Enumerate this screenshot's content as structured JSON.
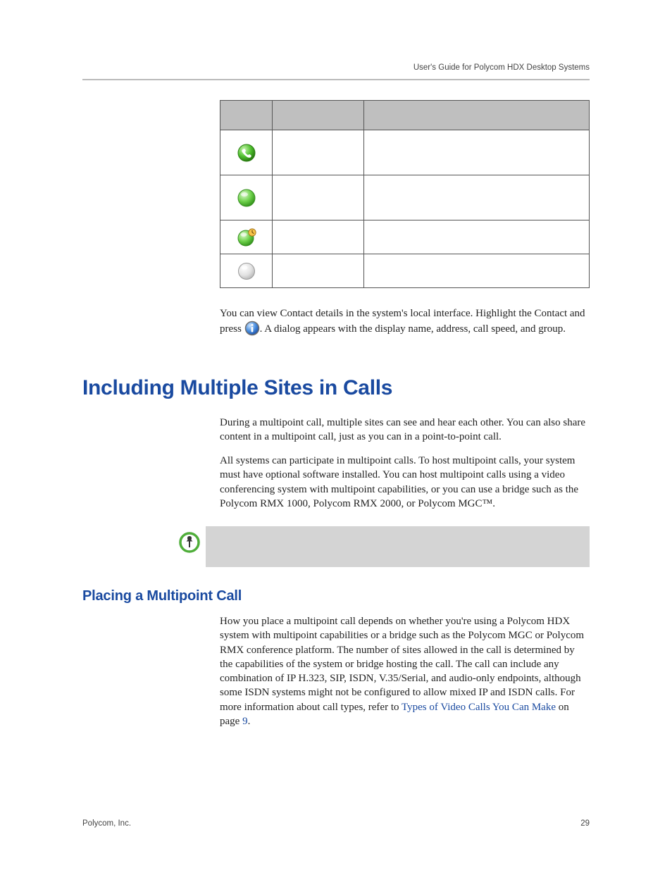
{
  "header": {
    "running": "User's Guide for Polycom HDX Desktop Systems"
  },
  "table": {
    "rows": [
      {
        "icon": "call-green-icon"
      },
      {
        "icon": "orb-green-icon"
      },
      {
        "icon": "orb-green-clock-icon"
      },
      {
        "icon": "orb-grey-icon"
      }
    ]
  },
  "contact_para": {
    "pre": "You can view Contact details in the system's local interface. Highlight the Contact and press ",
    "post": ". A dialog appears with the display name, address, call speed, and group."
  },
  "h1": "Including Multiple Sites in Calls",
  "p_intro1": "During a multipoint call, multiple sites can see and hear each other. You can also share content in a multipoint call, just as you can in a point-to-point call.",
  "p_intro2": "All systems can participate in multipoint calls. To host multipoint calls, your system must have optional software installed. You can host multipoint calls using a video conferencing system with multipoint capabilities, or you can use a bridge such as the Polycom RMX 1000, Polycom RMX 2000, or Polycom MGC™.",
  "h2": "Placing a Multipoint Call",
  "p_multi_pre": "How you place a multipoint call depends on whether you're using a Polycom HDX system with multipoint capabilities or a bridge such as the Polycom MGC or Polycom RMX conference platform. The number of sites allowed in the call is determined by the capabilities of the system or bridge hosting the call. The call can include any combination of IP H.323, SIP, ISDN, V.35/Serial, and audio-only endpoints, although some ISDN systems might not be configured to allow mixed IP and ISDN calls. For more information about call types, refer to ",
  "link_text": "Types of Video Calls You Can Make",
  "p_multi_mid": " on page ",
  "page_ref": "9",
  "p_multi_end": ".",
  "footer": {
    "left": "Polycom, Inc.",
    "right": "29"
  }
}
